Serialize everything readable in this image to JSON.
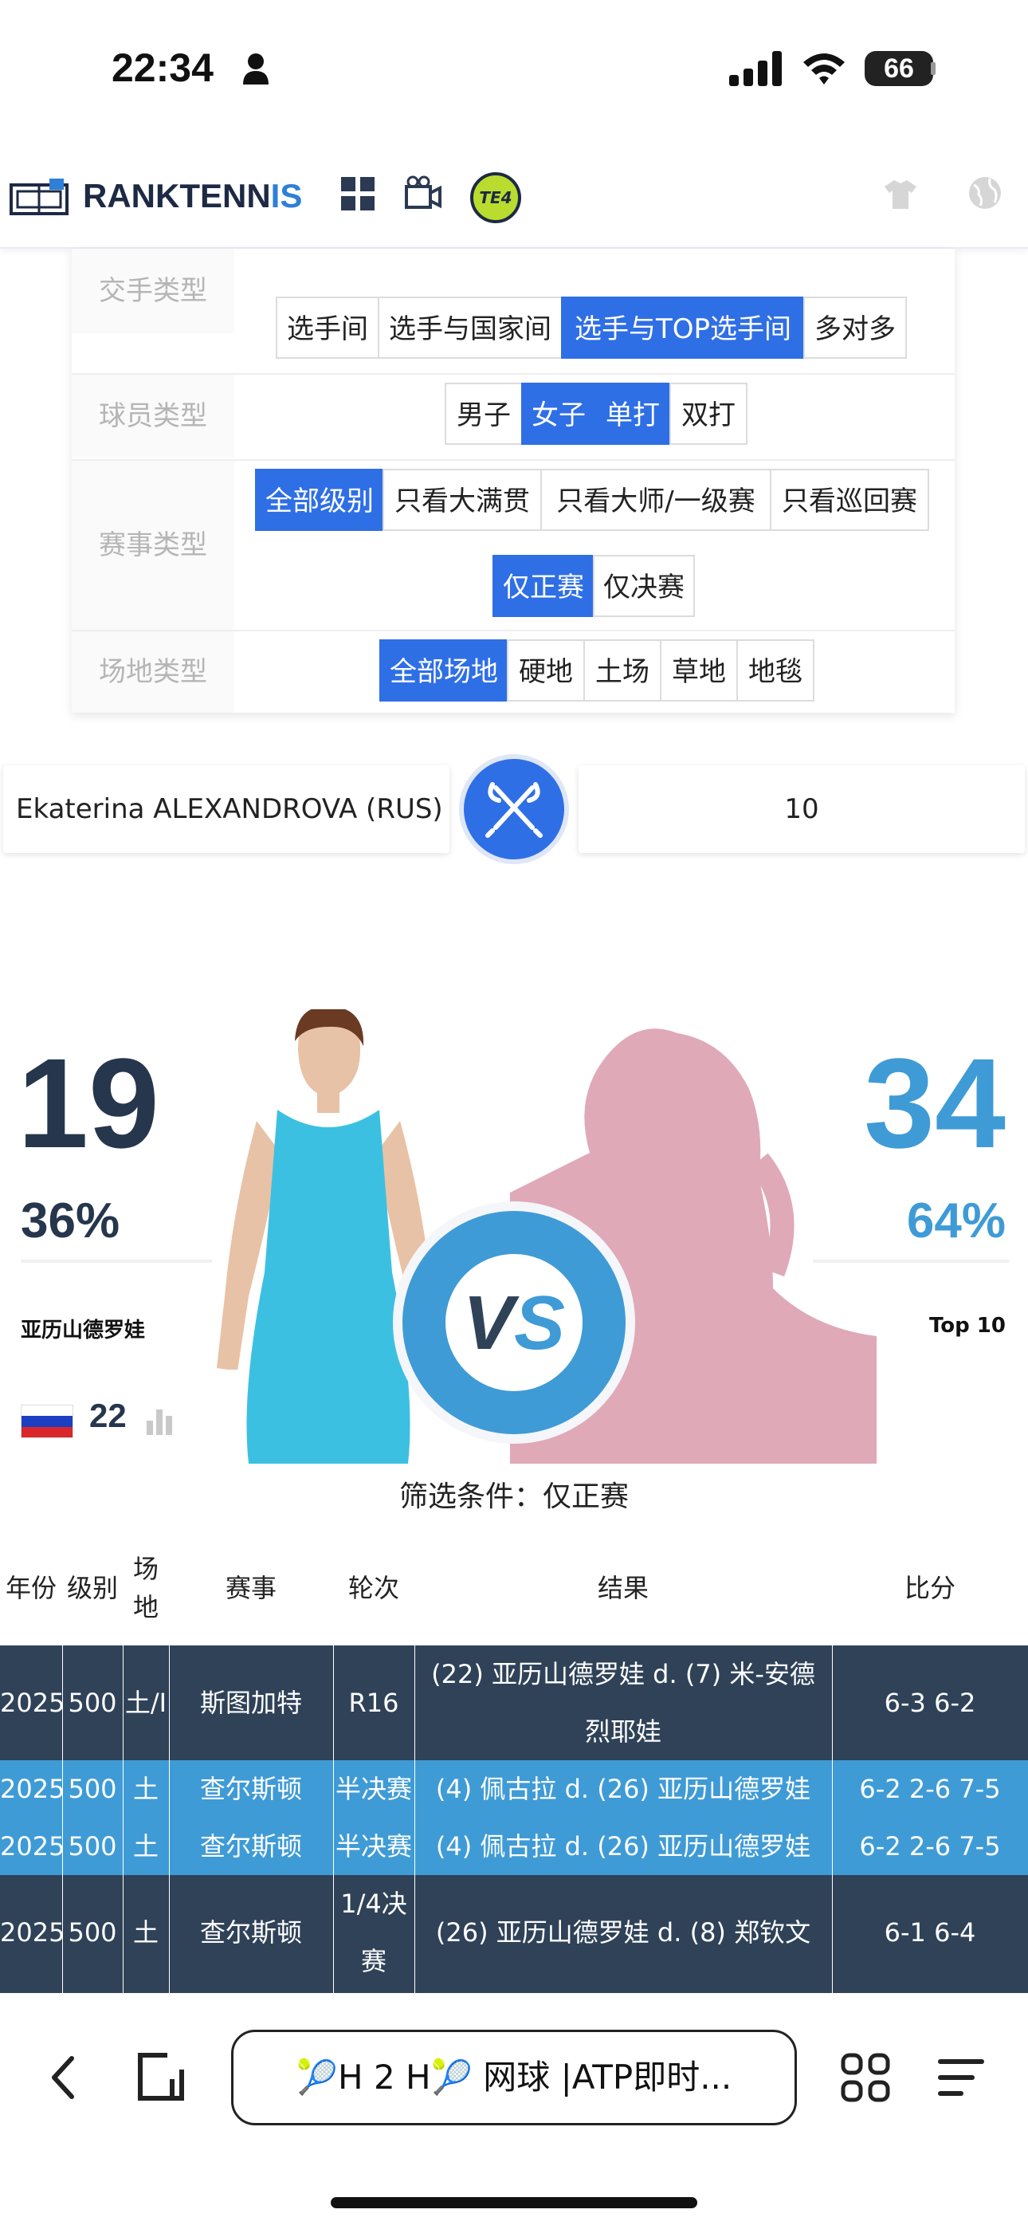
{
  "status_bar": {
    "time": "22:34",
    "battery": "66"
  },
  "header": {
    "logo_part1": "RANKTENN",
    "logo_part2": "IS",
    "badge": "TE4"
  },
  "filters": {
    "rows": [
      {
        "label": "交手类型",
        "options": [
          "选手间",
          "选手与国家间",
          "选手与TOP选手间",
          "多对多"
        ],
        "selected": "选手与TOP选手间"
      },
      {
        "label": "球员类型",
        "options": [
          "男子",
          "女子",
          "单打",
          "双打"
        ],
        "selected": [
          "女子",
          "单打"
        ]
      },
      {
        "label": "赛事类型",
        "options": [
          "全部级别",
          "只看大满贯",
          "只看大师/一级赛",
          "只看巡回赛",
          "仅正赛",
          "仅决赛"
        ],
        "selected": [
          "全部级别",
          "仅正赛"
        ]
      },
      {
        "label": "场地类型",
        "options": [
          "全部场地",
          "硬地",
          "土场",
          "草地",
          "地毯"
        ],
        "selected": "全部场地"
      }
    ]
  },
  "search": {
    "player": "Ekaterina ALEXANDROVA (RUS)",
    "opponent": "10"
  },
  "versus": {
    "left_wins": "19",
    "right_wins": "34",
    "left_pct": "36%",
    "right_pct": "64%",
    "left_name": "亚历山德罗娃",
    "right_name": "Top 10",
    "left_rank": "22",
    "vs_label": "VS",
    "left_share": 0.36
  },
  "table": {
    "caption": "筛选条件：仅正赛",
    "headers": [
      "年份",
      "级别",
      "场地",
      "赛事",
      "轮次",
      "结果",
      "比分"
    ],
    "rows": [
      {
        "style": "dark",
        "cells": [
          "2025",
          "500",
          "土/I",
          "斯图加特",
          "R16",
          "(22) 亚历山德罗娃 d. (7) 米-安德烈耶娃",
          "6-3 6-2"
        ]
      },
      {
        "style": "light",
        "cells": [
          "2025",
          "500",
          "土",
          "查尔斯顿",
          "半决赛",
          "(4) 佩古拉 d. (26) 亚历山德罗娃",
          "6-2 2-6 7-5"
        ]
      },
      {
        "style": "light",
        "cells": [
          "2025",
          "500",
          "土",
          "查尔斯顿",
          "半决赛",
          "(4) 佩古拉 d. (26) 亚历山德罗娃",
          "6-2 2-6 7-5"
        ]
      },
      {
        "style": "dark",
        "cells": [
          "2025",
          "500",
          "土",
          "查尔斯顿",
          "1/4决赛",
          "(26) 亚历山德罗娃 d. (8) 郑钦文",
          "6-1 6-4"
        ]
      }
    ]
  },
  "browser": {
    "url_text": "🎾H 2 H🎾 网球 |ATP即时..."
  },
  "colors": {
    "accent": "#2f6fe6",
    "dark_row": "#2f4258",
    "light_row": "#3f9bd6",
    "pink_silhouette": "#dfa9b8"
  }
}
